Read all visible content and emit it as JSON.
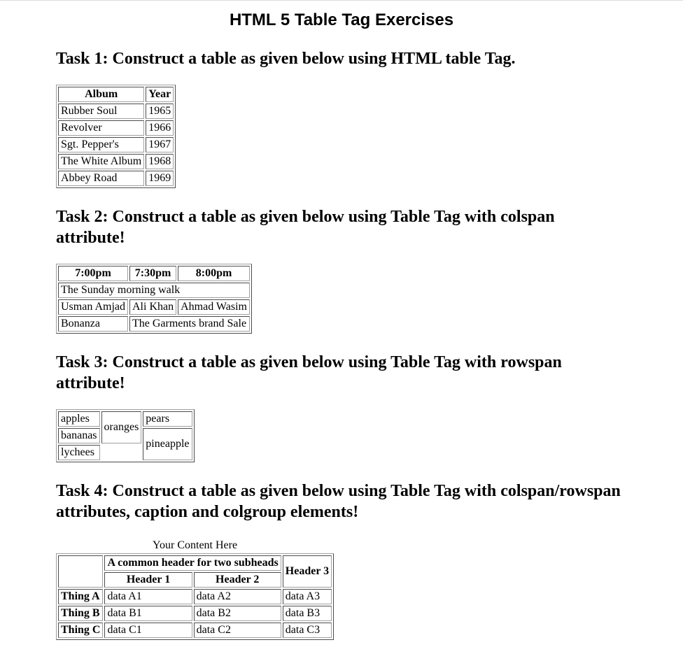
{
  "pageTitle": "HTML 5 Table Tag Exercises",
  "task1": {
    "heading": "Task 1: Construct a table as given below using HTML table Tag.",
    "headers": {
      "album": "Album",
      "year": "Year"
    },
    "rows": [
      {
        "album": "Rubber Soul",
        "year": "1965"
      },
      {
        "album": "Revolver",
        "year": "1966"
      },
      {
        "album": "Sgt. Pepper's",
        "year": "1967"
      },
      {
        "album": "The White Album",
        "year": "1968"
      },
      {
        "album": "Abbey Road",
        "year": "1969"
      }
    ]
  },
  "task2": {
    "heading": "Task 2: Construct a table as given below using Table Tag with colspan attribute!",
    "headers": {
      "c1": "7:00pm",
      "c2": "7:30pm",
      "c3": "8:00pm"
    },
    "row1": {
      "cell": "The Sunday morning walk"
    },
    "row2": {
      "c1": "Usman Amjad",
      "c2": "Ali Khan",
      "c3": "Ahmad Wasim"
    },
    "row3": {
      "c1": "Bonanza",
      "c23": "The Garments brand Sale"
    }
  },
  "task3": {
    "heading": "Task 3: Construct a table as given below using Table Tag with rowspan attribute!",
    "row1": {
      "c1": "apples",
      "c3": "pears"
    },
    "row_oranges": "oranges",
    "row2": {
      "c1": "bananas",
      "c3": "pineapple"
    },
    "row3": {
      "c1": "lychees"
    }
  },
  "task4": {
    "heading": "Task 4: Construct a table as given below using Table Tag with colspan/rowspan attributes, caption and colgroup elements!",
    "caption": "Your Content Here",
    "headers": {
      "common": "A common header for two subheads",
      "h1": "Header 1",
      "h2": "Header 2",
      "h3": "Header 3"
    },
    "rows": [
      {
        "label": "Thing A",
        "c1": "data A1",
        "c2": "data A2",
        "c3": "data A3"
      },
      {
        "label": "Thing B",
        "c1": "data B1",
        "c2": "data B2",
        "c3": "data B3"
      },
      {
        "label": "Thing C",
        "c1": "data C1",
        "c2": "data C2",
        "c3": "data C3"
      }
    ]
  }
}
